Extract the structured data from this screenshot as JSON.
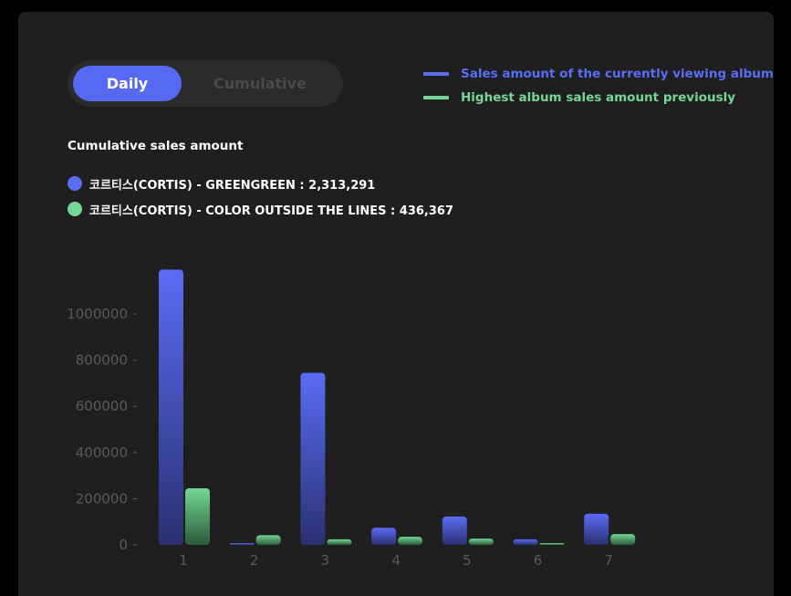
{
  "toggle": {
    "daily_label": "Daily",
    "cumulative_label": "Cumulative",
    "selected": "Daily"
  },
  "legend": {
    "current": "Sales amount of the currently viewing album",
    "previous": "Highest album sales amount previously"
  },
  "summary": {
    "heading": "Cumulative sales amount",
    "items": [
      "코르티스(CORTIS) - GREENGREEN : 2,313,291",
      "코르티스(CORTIS) - COLOR OUTSIDE THE LINES : 436,367"
    ]
  },
  "colors": {
    "current": "#5b6cf5",
    "previous": "#74d795",
    "axis_text": "#5a5a5a",
    "panel": "#1f1f1f"
  },
  "chart_data": {
    "type": "bar",
    "categories": [
      "1",
      "2",
      "3",
      "4",
      "5",
      "6",
      "7"
    ],
    "series": [
      {
        "name": "Sales amount of the currently viewing album",
        "values": [
          1192000,
          5000,
          745000,
          74000,
          123000,
          24000,
          135000
        ]
      },
      {
        "name": "Highest album sales amount previously",
        "values": [
          245000,
          42000,
          24000,
          35000,
          27000,
          5000,
          47000
        ]
      }
    ],
    "yticks": [
      0,
      200000,
      400000,
      600000,
      800000,
      1000000
    ],
    "ylim": [
      0,
      1200000
    ],
    "grid": false,
    "legend_position": "top-right"
  }
}
